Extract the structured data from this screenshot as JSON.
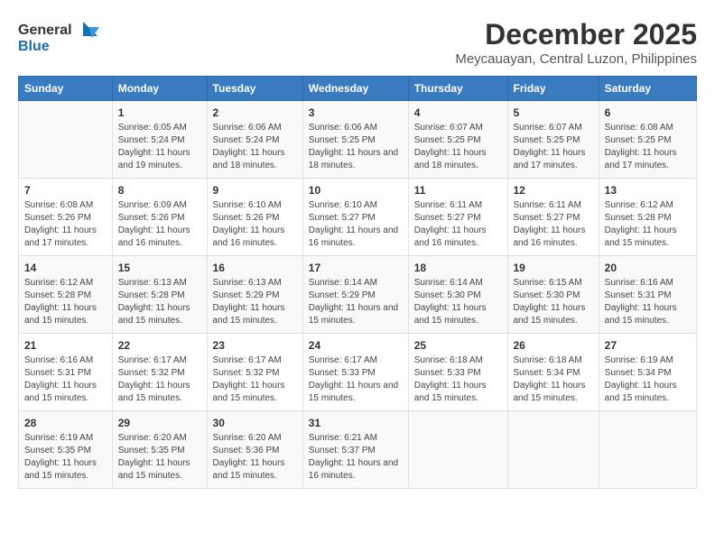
{
  "logo": {
    "line1": "General",
    "line2": "Blue"
  },
  "title": "December 2025",
  "subtitle": "Meycauayan, Central Luzon, Philippines",
  "headers": [
    "Sunday",
    "Monday",
    "Tuesday",
    "Wednesday",
    "Thursday",
    "Friday",
    "Saturday"
  ],
  "weeks": [
    [
      {
        "day": "",
        "sunrise": "",
        "sunset": "",
        "daylight": ""
      },
      {
        "day": "1",
        "sunrise": "Sunrise: 6:05 AM",
        "sunset": "Sunset: 5:24 PM",
        "daylight": "Daylight: 11 hours and 19 minutes."
      },
      {
        "day": "2",
        "sunrise": "Sunrise: 6:06 AM",
        "sunset": "Sunset: 5:24 PM",
        "daylight": "Daylight: 11 hours and 18 minutes."
      },
      {
        "day": "3",
        "sunrise": "Sunrise: 6:06 AM",
        "sunset": "Sunset: 5:25 PM",
        "daylight": "Daylight: 11 hours and 18 minutes."
      },
      {
        "day": "4",
        "sunrise": "Sunrise: 6:07 AM",
        "sunset": "Sunset: 5:25 PM",
        "daylight": "Daylight: 11 hours and 18 minutes."
      },
      {
        "day": "5",
        "sunrise": "Sunrise: 6:07 AM",
        "sunset": "Sunset: 5:25 PM",
        "daylight": "Daylight: 11 hours and 17 minutes."
      },
      {
        "day": "6",
        "sunrise": "Sunrise: 6:08 AM",
        "sunset": "Sunset: 5:25 PM",
        "daylight": "Daylight: 11 hours and 17 minutes."
      }
    ],
    [
      {
        "day": "7",
        "sunrise": "Sunrise: 6:08 AM",
        "sunset": "Sunset: 5:26 PM",
        "daylight": "Daylight: 11 hours and 17 minutes."
      },
      {
        "day": "8",
        "sunrise": "Sunrise: 6:09 AM",
        "sunset": "Sunset: 5:26 PM",
        "daylight": "Daylight: 11 hours and 16 minutes."
      },
      {
        "day": "9",
        "sunrise": "Sunrise: 6:10 AM",
        "sunset": "Sunset: 5:26 PM",
        "daylight": "Daylight: 11 hours and 16 minutes."
      },
      {
        "day": "10",
        "sunrise": "Sunrise: 6:10 AM",
        "sunset": "Sunset: 5:27 PM",
        "daylight": "Daylight: 11 hours and 16 minutes."
      },
      {
        "day": "11",
        "sunrise": "Sunrise: 6:11 AM",
        "sunset": "Sunset: 5:27 PM",
        "daylight": "Daylight: 11 hours and 16 minutes."
      },
      {
        "day": "12",
        "sunrise": "Sunrise: 6:11 AM",
        "sunset": "Sunset: 5:27 PM",
        "daylight": "Daylight: 11 hours and 16 minutes."
      },
      {
        "day": "13",
        "sunrise": "Sunrise: 6:12 AM",
        "sunset": "Sunset: 5:28 PM",
        "daylight": "Daylight: 11 hours and 15 minutes."
      }
    ],
    [
      {
        "day": "14",
        "sunrise": "Sunrise: 6:12 AM",
        "sunset": "Sunset: 5:28 PM",
        "daylight": "Daylight: 11 hours and 15 minutes."
      },
      {
        "day": "15",
        "sunrise": "Sunrise: 6:13 AM",
        "sunset": "Sunset: 5:28 PM",
        "daylight": "Daylight: 11 hours and 15 minutes."
      },
      {
        "day": "16",
        "sunrise": "Sunrise: 6:13 AM",
        "sunset": "Sunset: 5:29 PM",
        "daylight": "Daylight: 11 hours and 15 minutes."
      },
      {
        "day": "17",
        "sunrise": "Sunrise: 6:14 AM",
        "sunset": "Sunset: 5:29 PM",
        "daylight": "Daylight: 11 hours and 15 minutes."
      },
      {
        "day": "18",
        "sunrise": "Sunrise: 6:14 AM",
        "sunset": "Sunset: 5:30 PM",
        "daylight": "Daylight: 11 hours and 15 minutes."
      },
      {
        "day": "19",
        "sunrise": "Sunrise: 6:15 AM",
        "sunset": "Sunset: 5:30 PM",
        "daylight": "Daylight: 11 hours and 15 minutes."
      },
      {
        "day": "20",
        "sunrise": "Sunrise: 6:16 AM",
        "sunset": "Sunset: 5:31 PM",
        "daylight": "Daylight: 11 hours and 15 minutes."
      }
    ],
    [
      {
        "day": "21",
        "sunrise": "Sunrise: 6:16 AM",
        "sunset": "Sunset: 5:31 PM",
        "daylight": "Daylight: 11 hours and 15 minutes."
      },
      {
        "day": "22",
        "sunrise": "Sunrise: 6:17 AM",
        "sunset": "Sunset: 5:32 PM",
        "daylight": "Daylight: 11 hours and 15 minutes."
      },
      {
        "day": "23",
        "sunrise": "Sunrise: 6:17 AM",
        "sunset": "Sunset: 5:32 PM",
        "daylight": "Daylight: 11 hours and 15 minutes."
      },
      {
        "day": "24",
        "sunrise": "Sunrise: 6:17 AM",
        "sunset": "Sunset: 5:33 PM",
        "daylight": "Daylight: 11 hours and 15 minutes."
      },
      {
        "day": "25",
        "sunrise": "Sunrise: 6:18 AM",
        "sunset": "Sunset: 5:33 PM",
        "daylight": "Daylight: 11 hours and 15 minutes."
      },
      {
        "day": "26",
        "sunrise": "Sunrise: 6:18 AM",
        "sunset": "Sunset: 5:34 PM",
        "daylight": "Daylight: 11 hours and 15 minutes."
      },
      {
        "day": "27",
        "sunrise": "Sunrise: 6:19 AM",
        "sunset": "Sunset: 5:34 PM",
        "daylight": "Daylight: 11 hours and 15 minutes."
      }
    ],
    [
      {
        "day": "28",
        "sunrise": "Sunrise: 6:19 AM",
        "sunset": "Sunset: 5:35 PM",
        "daylight": "Daylight: 11 hours and 15 minutes."
      },
      {
        "day": "29",
        "sunrise": "Sunrise: 6:20 AM",
        "sunset": "Sunset: 5:35 PM",
        "daylight": "Daylight: 11 hours and 15 minutes."
      },
      {
        "day": "30",
        "sunrise": "Sunrise: 6:20 AM",
        "sunset": "Sunset: 5:36 PM",
        "daylight": "Daylight: 11 hours and 15 minutes."
      },
      {
        "day": "31",
        "sunrise": "Sunrise: 6:21 AM",
        "sunset": "Sunset: 5:37 PM",
        "daylight": "Daylight: 11 hours and 16 minutes."
      },
      {
        "day": "",
        "sunrise": "",
        "sunset": "",
        "daylight": ""
      },
      {
        "day": "",
        "sunrise": "",
        "sunset": "",
        "daylight": ""
      },
      {
        "day": "",
        "sunrise": "",
        "sunset": "",
        "daylight": ""
      }
    ]
  ]
}
